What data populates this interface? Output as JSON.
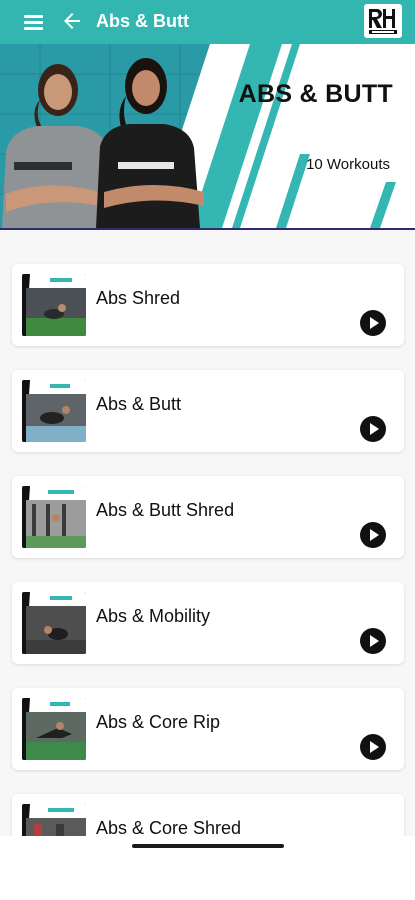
{
  "appbar": {
    "title": "Abs & Butt",
    "menu_icon": "menu-icon",
    "back_icon": "arrow-left-icon",
    "logo_icon": "rh-workout-logo",
    "color": "#33b5b0"
  },
  "hero": {
    "title": "ABS & BUTT",
    "workout_count": "10 Workouts",
    "accent": "#34b6b2",
    "divider_color": "#2c2c6e"
  },
  "workouts": [
    {
      "name": "Abs Shred",
      "play_icon": "play-icon"
    },
    {
      "name": "Abs & Butt",
      "play_icon": "play-icon"
    },
    {
      "name": "Abs & Butt Shred",
      "play_icon": "play-icon"
    },
    {
      "name": "Abs & Mobility",
      "play_icon": "play-icon"
    },
    {
      "name": "Abs & Core Rip",
      "play_icon": "play-icon"
    },
    {
      "name": "Abs & Core Shred",
      "play_icon": "play-icon"
    }
  ]
}
